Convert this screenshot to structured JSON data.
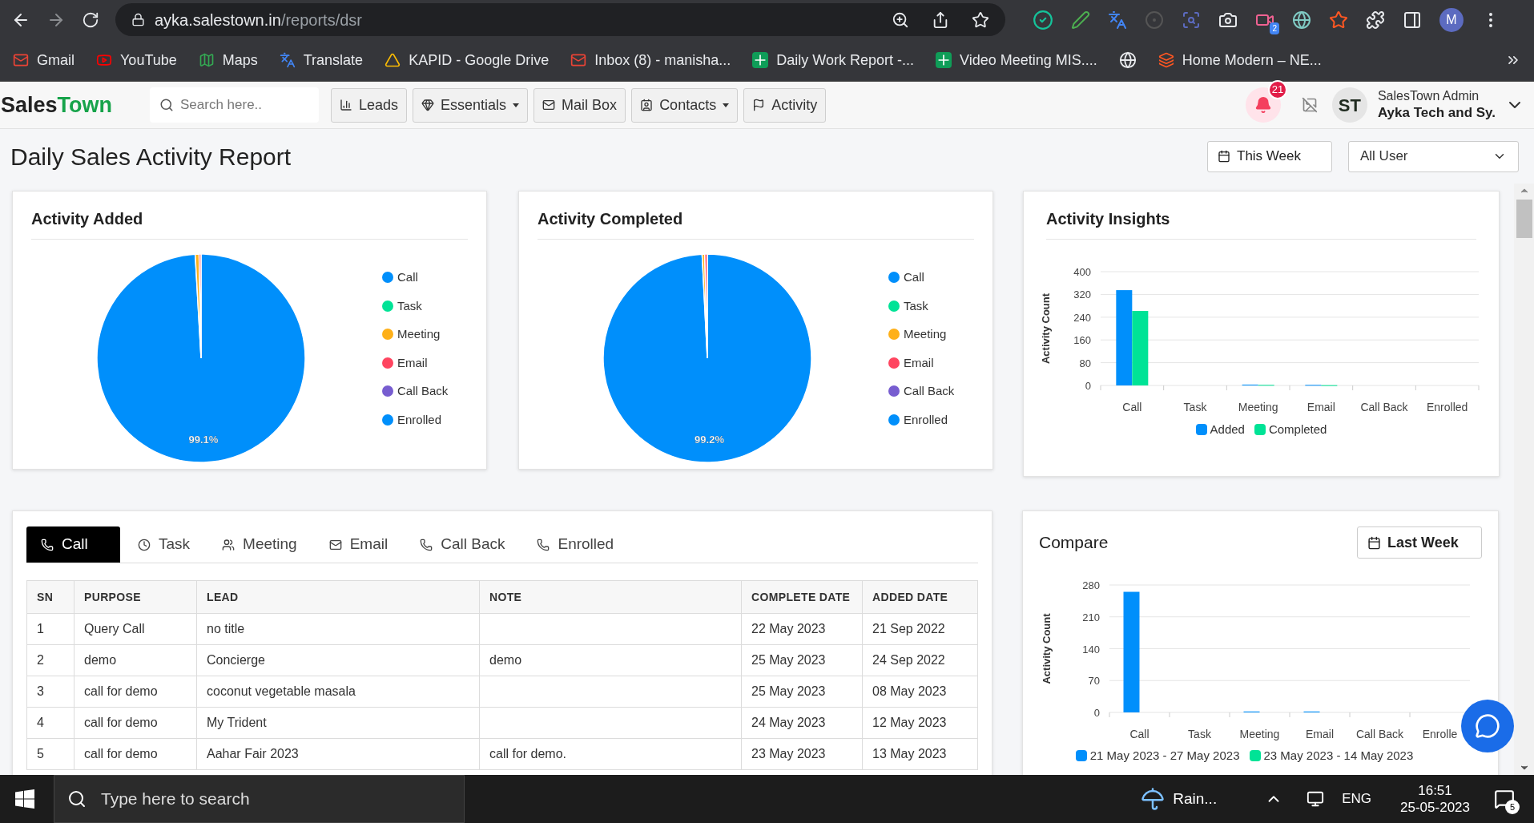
{
  "browser": {
    "url_host": "ayka.salestown.in",
    "url_path": "/reports/dsr",
    "extension_badge": "2",
    "profile_initial": "M"
  },
  "bookmarks": [
    {
      "label": "Gmail"
    },
    {
      "label": "YouTube"
    },
    {
      "label": "Maps"
    },
    {
      "label": "Translate"
    },
    {
      "label": "KAPID - Google Drive"
    },
    {
      "label": "Inbox (8) - manisha..."
    },
    {
      "label": "Daily Work Report -..."
    },
    {
      "label": "Video Meeting MIS...."
    },
    {
      "label": "Home Modern – NE..."
    }
  ],
  "app": {
    "logo_first": "Sales",
    "logo_second": "Town",
    "search": {
      "placeholder": "Search here.."
    },
    "nav": [
      {
        "label": "Leads",
        "dropdown": false
      },
      {
        "label": "Essentials",
        "dropdown": true
      },
      {
        "label": "Mail Box",
        "dropdown": false
      },
      {
        "label": "Contacts",
        "dropdown": true
      },
      {
        "label": "Activity",
        "dropdown": false
      }
    ],
    "notification_count": "21",
    "avatar_initials": "ST",
    "user_name": "SalesTown Admin",
    "company": "Ayka Tech and Sy."
  },
  "page": {
    "title": "Daily Sales Activity Report",
    "period_button": "This Week",
    "user_select": "All User"
  },
  "pies": [
    {
      "title": "Activity Added",
      "legend": [
        {
          "color": "#008ffb"
        },
        {
          "color": "#00e396"
        },
        {
          "color": "#feb019"
        },
        {
          "color": "#ff4560"
        },
        {
          "color": "#775dd0"
        },
        {
          "color": "#008ffb"
        }
      ],
      "chart_data": {
        "type": "pie",
        "categories": [
          "Call",
          "Task",
          "Meeting",
          "Email",
          "Call Back",
          "Enrolled"
        ],
        "values": [
          99.1,
          0,
          0.6,
          0.3,
          0,
          0
        ],
        "value_labels": [
          "99.1%",
          null,
          null,
          null,
          null,
          null
        ]
      }
    },
    {
      "title": "Activity Completed",
      "legend": [
        {
          "color": "#008ffb"
        },
        {
          "color": "#00e396"
        },
        {
          "color": "#feb019"
        },
        {
          "color": "#ff4560"
        },
        {
          "color": "#775dd0"
        },
        {
          "color": "#008ffb"
        }
      ],
      "chart_data": {
        "type": "pie",
        "categories": [
          "Call",
          "Task",
          "Meeting",
          "Email",
          "Call Back",
          "Enrolled"
        ],
        "values": [
          99.2,
          0,
          0.4,
          0.4,
          0,
          0
        ],
        "value_labels": [
          "99.2%",
          null,
          null,
          null,
          null,
          null
        ]
      }
    }
  ],
  "insights": {
    "title": "Activity Insights",
    "chart_data": {
      "type": "bar",
      "ylabel": "Activity Count",
      "categories": [
        "Call",
        "Task",
        "Meeting",
        "Email",
        "Call Back",
        "Enrolled"
      ],
      "series": [
        {
          "name": "Added",
          "color": "#008ffb",
          "values": [
            335,
            0,
            3,
            2,
            0,
            0
          ]
        },
        {
          "name": "Completed",
          "color": "#00e396",
          "values": [
            262,
            0,
            2,
            1,
            0,
            0
          ]
        }
      ],
      "ylim": [
        0,
        400
      ],
      "yticks": [
        0,
        80,
        160,
        240,
        320,
        400
      ],
      "grid": true
    }
  },
  "tabs": [
    {
      "label": "Call",
      "selected": true
    },
    {
      "label": "Task",
      "selected": false
    },
    {
      "label": "Meeting",
      "selected": false
    },
    {
      "label": "Email",
      "selected": false
    },
    {
      "label": "Call Back",
      "selected": false
    },
    {
      "label": "Enrolled",
      "selected": false
    }
  ],
  "table": {
    "columns": [
      "SN",
      "PURPOSE",
      "LEAD",
      "NOTE",
      "COMPLETE DATE",
      "ADDED DATE"
    ],
    "rows": [
      [
        "1",
        "Query Call",
        "no title",
        "",
        "22 May 2023",
        "21 Sep 2022"
      ],
      [
        "2",
        "demo",
        "Concierge",
        "demo",
        "25 May 2023",
        "24 Sep 2022"
      ],
      [
        "3",
        "call for demo",
        "coconut vegetable masala",
        "",
        "25 May 2023",
        "08 May 2023"
      ],
      [
        "4",
        "call for demo",
        "My Trident",
        "",
        "24 May 2023",
        "12 May 2023"
      ],
      [
        "5",
        "call for demo",
        "Aahar Fair 2023",
        "call for demo.",
        "23 May 2023",
        "13 May 2023"
      ]
    ]
  },
  "compare": {
    "title": "Compare",
    "period_button": "Last Week",
    "chart_data": {
      "type": "bar",
      "ylabel": "Activity Count",
      "categories": [
        "Call",
        "Task",
        "Meeting",
        "Email",
        "Call Back",
        "Enrolle"
      ],
      "series": [
        {
          "name": "21 May 2023 - 27 May 2023",
          "color": "#008ffb",
          "values": [
            265,
            0,
            2,
            2,
            0,
            0
          ]
        },
        {
          "name": "23 May 2023 - 14 May 2023",
          "color": "#00e396",
          "values": [
            0,
            0,
            0,
            0,
            0,
            0
          ]
        }
      ],
      "ylim": [
        0,
        280
      ],
      "yticks": [
        0,
        70,
        140,
        210,
        280
      ],
      "grid": true
    }
  },
  "taskbar": {
    "search": {
      "placeholder": "Type here to search"
    },
    "weather": "Rain...",
    "language": "ENG",
    "time": "16:51",
    "date": "25-05-2023",
    "notification_count": "5"
  }
}
